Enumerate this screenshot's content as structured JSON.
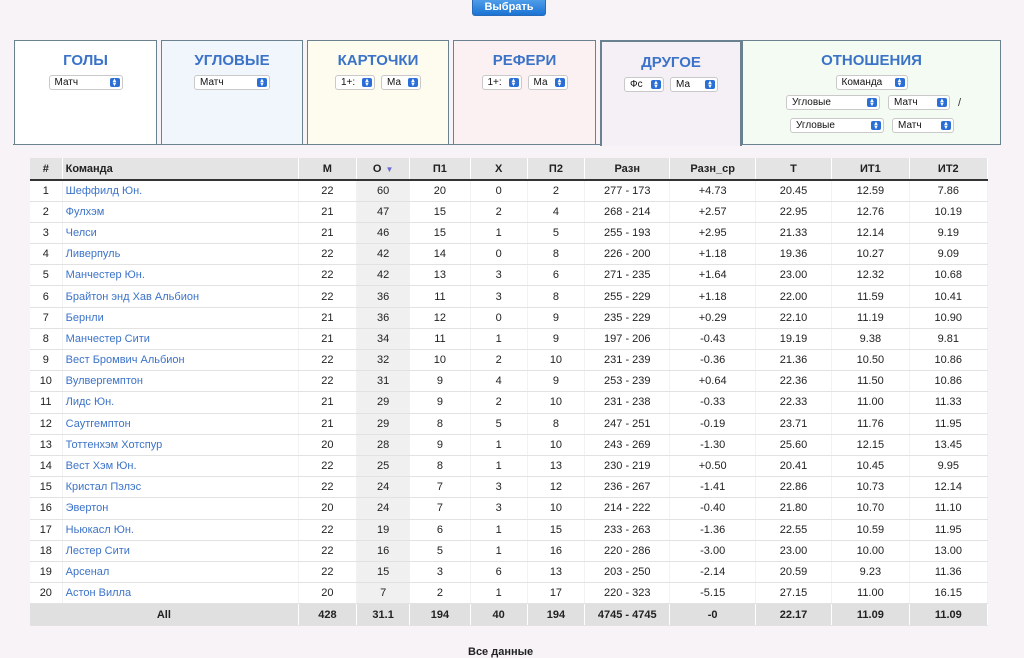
{
  "select_button": "Выбрать",
  "tabs": [
    {
      "title": "ГОЛЫ",
      "bg": "#ffffff",
      "selects": [
        "Матч"
      ]
    },
    {
      "title": "УГЛОВЫЕ",
      "bg": "#f1f5fc",
      "selects": [
        "Матч"
      ]
    },
    {
      "title": "КАРТОЧКИ",
      "bg": "#fdfcee",
      "selects": [
        "1+:",
        "Ма"
      ]
    },
    {
      "title": "РЕФЕРИ",
      "bg": "#fcf1f2",
      "selects": [
        "1+:",
        "Ма"
      ]
    },
    {
      "title": "ДРУГОЕ",
      "bg": "#f4f0f6",
      "selects": [
        "Фс",
        "Ма"
      ]
    },
    {
      "title": "ОТНОШЕНИЯ",
      "bg": "#f4fbf2",
      "selects": [
        "Команда"
      ]
    }
  ],
  "relations": {
    "row1": {
      "left": "Угловые",
      "right": "Матч",
      "sep": "/"
    },
    "row2": {
      "left": "Угловые",
      "right": "Матч"
    }
  },
  "table": {
    "headers": [
      "#",
      "Команда",
      "М",
      "О",
      "П1",
      "Х",
      "П2",
      "Разн",
      "Разн_ср",
      "Т",
      "ИТ1",
      "ИТ2"
    ],
    "rows": [
      [
        "1",
        "Шеффилд Юн.",
        "22",
        "60",
        "20",
        "0",
        "2",
        "277 - 173",
        "+4.73",
        "20.45",
        "12.59",
        "7.86"
      ],
      [
        "2",
        "Фулхэм",
        "21",
        "47",
        "15",
        "2",
        "4",
        "268 - 214",
        "+2.57",
        "22.95",
        "12.76",
        "10.19"
      ],
      [
        "3",
        "Челси",
        "21",
        "46",
        "15",
        "1",
        "5",
        "255 - 193",
        "+2.95",
        "21.33",
        "12.14",
        "9.19"
      ],
      [
        "4",
        "Ливерпуль",
        "22",
        "42",
        "14",
        "0",
        "8",
        "226 - 200",
        "+1.18",
        "19.36",
        "10.27",
        "9.09"
      ],
      [
        "5",
        "Манчестер Юн.",
        "22",
        "42",
        "13",
        "3",
        "6",
        "271 - 235",
        "+1.64",
        "23.00",
        "12.32",
        "10.68"
      ],
      [
        "6",
        "Брайтон энд Хав Альбион",
        "22",
        "36",
        "11",
        "3",
        "8",
        "255 - 229",
        "+1.18",
        "22.00",
        "11.59",
        "10.41"
      ],
      [
        "7",
        "Бернли",
        "21",
        "36",
        "12",
        "0",
        "9",
        "235 - 229",
        "+0.29",
        "22.10",
        "11.19",
        "10.90"
      ],
      [
        "8",
        "Манчестер Сити",
        "21",
        "34",
        "11",
        "1",
        "9",
        "197 - 206",
        "-0.43",
        "19.19",
        "9.38",
        "9.81"
      ],
      [
        "9",
        "Вест Бромвич Альбион",
        "22",
        "32",
        "10",
        "2",
        "10",
        "231 - 239",
        "-0.36",
        "21.36",
        "10.50",
        "10.86"
      ],
      [
        "10",
        "Вулвергемптон",
        "22",
        "31",
        "9",
        "4",
        "9",
        "253 - 239",
        "+0.64",
        "22.36",
        "11.50",
        "10.86"
      ],
      [
        "11",
        "Лидс Юн.",
        "21",
        "29",
        "9",
        "2",
        "10",
        "231 - 238",
        "-0.33",
        "22.33",
        "11.00",
        "11.33"
      ],
      [
        "12",
        "Саутгемптон",
        "21",
        "29",
        "8",
        "5",
        "8",
        "247 - 251",
        "-0.19",
        "23.71",
        "11.76",
        "11.95"
      ],
      [
        "13",
        "Тоттенхэм Хотспур",
        "20",
        "28",
        "9",
        "1",
        "10",
        "243 - 269",
        "-1.30",
        "25.60",
        "12.15",
        "13.45"
      ],
      [
        "14",
        "Вест Хэм Юн.",
        "22",
        "25",
        "8",
        "1",
        "13",
        "230 - 219",
        "+0.50",
        "20.41",
        "10.45",
        "9.95"
      ],
      [
        "15",
        "Кристал Пэлэс",
        "22",
        "24",
        "7",
        "3",
        "12",
        "236 - 267",
        "-1.41",
        "22.86",
        "10.73",
        "12.14"
      ],
      [
        "16",
        "Эвертон",
        "20",
        "24",
        "7",
        "3",
        "10",
        "214 - 222",
        "-0.40",
        "21.80",
        "10.70",
        "11.10"
      ],
      [
        "17",
        "Ньюкасл Юн.",
        "22",
        "19",
        "6",
        "1",
        "15",
        "233 - 263",
        "-1.36",
        "22.55",
        "10.59",
        "11.95"
      ],
      [
        "18",
        "Лестер Сити",
        "22",
        "16",
        "5",
        "1",
        "16",
        "220 - 286",
        "-3.00",
        "23.00",
        "10.00",
        "13.00"
      ],
      [
        "19",
        "Арсенал",
        "22",
        "15",
        "3",
        "6",
        "13",
        "203 - 250",
        "-2.14",
        "20.59",
        "9.23",
        "11.36"
      ],
      [
        "20",
        "Астон Вилла",
        "20",
        "7",
        "2",
        "1",
        "17",
        "220 - 323",
        "-5.15",
        "27.15",
        "11.00",
        "16.15"
      ]
    ],
    "total": [
      "All",
      "428",
      "31.1",
      "194",
      "40",
      "194",
      "4745 - 4745",
      "-0",
      "22.17",
      "11.09",
      "11.09"
    ]
  },
  "footer_text": "Все данные"
}
